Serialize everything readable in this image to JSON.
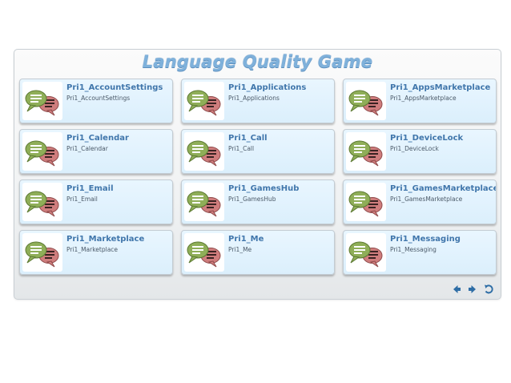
{
  "app": {
    "title": "Language Quality Game"
  },
  "tiles": [
    {
      "title": "Pri1_AccountSettings",
      "subtitle": "Pri1_AccountSettings",
      "icon": "chat-bubbles-icon"
    },
    {
      "title": "Pri1_Applications",
      "subtitle": "Pri1_Applications",
      "icon": "chat-bubbles-icon"
    },
    {
      "title": "Pri1_AppsMarketplace",
      "subtitle": "Pri1_AppsMarketplace",
      "icon": "chat-bubbles-icon"
    },
    {
      "title": "Pri1_Calendar",
      "subtitle": "Pri1_Calendar",
      "icon": "chat-bubbles-icon"
    },
    {
      "title": "Pri1_Call",
      "subtitle": "Pri1_Call",
      "icon": "chat-bubbles-icon"
    },
    {
      "title": "Pri1_DeviceLock",
      "subtitle": "Pri1_DeviceLock",
      "icon": "chat-bubbles-icon"
    },
    {
      "title": "Pri1_Email",
      "subtitle": "Pri1_Email",
      "icon": "chat-bubbles-icon"
    },
    {
      "title": "Pri1_GamesHub",
      "subtitle": "Pri1_GamesHub",
      "icon": "chat-bubbles-icon"
    },
    {
      "title": "Pri1_GamesMarketplace",
      "subtitle": "Pri1_GamesMarketplace",
      "icon": "chat-bubbles-icon"
    },
    {
      "title": "Pri1_Marketplace",
      "subtitle": "Pri1_Marketplace",
      "icon": "chat-bubbles-icon"
    },
    {
      "title": "Pri1_Me",
      "subtitle": "Pri1_Me",
      "icon": "chat-bubbles-icon"
    },
    {
      "title": "Pri1_Messaging",
      "subtitle": "Pri1_Messaging",
      "icon": "chat-bubbles-icon"
    }
  ],
  "nav": {
    "back_icon": "arrow-left-icon",
    "forward_icon": "arrow-right-icon",
    "return_icon": "return-icon"
  },
  "colors": {
    "title": "#7fb1db",
    "tile_background": "#e2f3fe",
    "tile_title": "#4076ab",
    "bubble_green": "#8fae58",
    "bubble_red": "#cf7d7d",
    "nav_icon": "#2f6ea6"
  }
}
